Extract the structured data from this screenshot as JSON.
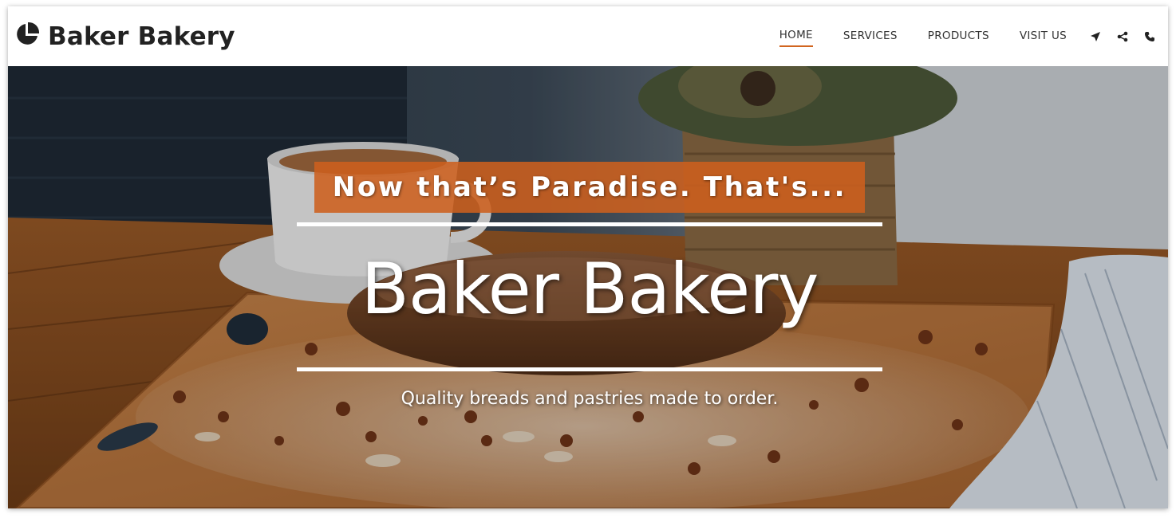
{
  "brand": {
    "name": "Baker Bakery",
    "icon": "pie-chart-icon"
  },
  "nav": {
    "items": [
      {
        "label": "HOME",
        "active": true
      },
      {
        "label": "SERVICES",
        "active": false
      },
      {
        "label": "PRODUCTS",
        "active": false
      },
      {
        "label": "VISIT US",
        "active": false
      }
    ],
    "icons": [
      "location-arrow-icon",
      "share-icon",
      "phone-icon"
    ]
  },
  "hero": {
    "tagline": "Now that’s Paradise. That's...",
    "title": "Baker Bakery",
    "subtitle": "Quality breads and pastries made to order."
  },
  "colors": {
    "accent": "#d1651f",
    "tagline_bg": "#cd601e",
    "nav_text": "#333333",
    "hero_text": "#ffffff"
  }
}
